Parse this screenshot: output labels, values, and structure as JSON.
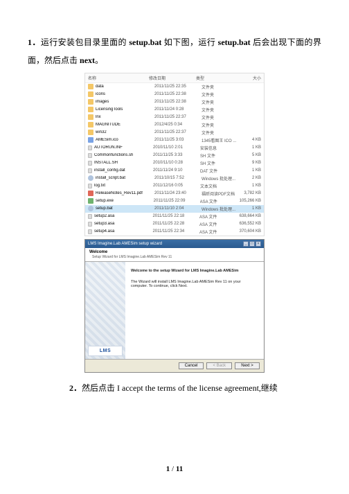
{
  "para1": {
    "num": "1．",
    "t1": "运行安装包目录里面的 ",
    "b1": "setup.bat",
    "t2": " 如下图，运行 ",
    "b2": "setup.bat",
    "t3": " 后会出现下面的界面，然后点击 ",
    "b3": "next",
    "t4": "。"
  },
  "explorer": {
    "head": {
      "name": "名称",
      "date": "修改日期",
      "type": "类型",
      "size": "大小"
    },
    "rows": [
      {
        "ic": "folder",
        "name": "data",
        "date": "2011/11/25 22:35",
        "type": "文件夹",
        "size": ""
      },
      {
        "ic": "folder",
        "name": "icons",
        "date": "2011/11/25 22:38",
        "type": "文件夹",
        "size": ""
      },
      {
        "ic": "folder",
        "name": "images",
        "date": "2011/11/25 22:38",
        "type": "文件夹",
        "size": ""
      },
      {
        "ic": "folder",
        "name": "LicensingTools",
        "date": "2011/11/24 0:28",
        "type": "文件夹",
        "size": ""
      },
      {
        "ic": "folder",
        "name": "lnx",
        "date": "2011/11/25 22:37",
        "type": "文件夹",
        "size": ""
      },
      {
        "ic": "folder",
        "name": "MAGNITUDE",
        "date": "2012/4/25 0:34",
        "type": "文件夹",
        "size": ""
      },
      {
        "ic": "folder",
        "name": "win32",
        "date": "2011/11/25 22:37",
        "type": "文件夹",
        "size": ""
      },
      {
        "ic": "ico",
        "name": "AMESim.ico",
        "date": "2011/11/25 3:03",
        "type": "1345看图王 ICO ...",
        "size": "4 KB"
      },
      {
        "ic": "file",
        "name": "AUTORUN.INF",
        "date": "2010/11/10 2:01",
        "type": "安装信息",
        "size": "1 KB"
      },
      {
        "ic": "file",
        "name": "Commonfunctions.sh",
        "date": "2011/11/25 3:33",
        "type": "SH 文件",
        "size": "5 KB"
      },
      {
        "ic": "file",
        "name": "INSTALL.SH",
        "date": "2010/11/10 0:28",
        "type": "SH 文件",
        "size": "9 KB"
      },
      {
        "ic": "file",
        "name": "install_config.dat",
        "date": "2011/11/24 9:10",
        "type": "DAT 文件",
        "size": "1 KB"
      },
      {
        "ic": "gear",
        "name": "install_script.bat",
        "date": "2011/10/15 7:52",
        "type": "Windows 批处理...",
        "size": "2 KB"
      },
      {
        "ic": "file",
        "name": "log.txt",
        "date": "2011/12/16 0:05",
        "type": "文本文档",
        "size": "1 KB"
      },
      {
        "ic": "pdf",
        "name": "ReleaseNotes_Rev11.pdf",
        "date": "2011/11/24 23:40",
        "type": "福昕阅读PDF文档",
        "size": "3,782 KB"
      },
      {
        "ic": "exe",
        "name": "setup.exe",
        "date": "2011/11/25 22:09",
        "type": "ASA 文件",
        "size": "105,266 KB"
      },
      {
        "ic": "gear",
        "name": "setup.bat",
        "date": "2011/11/10 2:04",
        "type": "Windows 批处理...",
        "size": "1 KB",
        "sel": true
      },
      {
        "ic": "file",
        "name": "setup2.asa",
        "date": "2011/11/25 22:18",
        "type": "ASA 文件",
        "size": "638,664 KB"
      },
      {
        "ic": "file",
        "name": "setup3.asa",
        "date": "2011/11/25 22:28",
        "type": "ASA 文件",
        "size": "636,552 KB"
      },
      {
        "ic": "file",
        "name": "setup4.asa",
        "date": "2011/11/25 22:34",
        "type": "ASA 文件",
        "size": "370,604 KB"
      }
    ]
  },
  "wizard": {
    "title": "LMS Imagine.Lab AMESim setup wizard",
    "header": "Welcome",
    "subheader": "Setup Wizard for LMS Imagine.Lab AMESim Rev 11",
    "body1": "Welcome to the setup Wizard for LMS Imagine.Lab AMESim",
    "body2": "The Wizard will install LMS Imagine.Lab AMESim Rev 11 on your computer. To continue, click Next.",
    "logo": "LMS",
    "btn_cancel": "Cancel",
    "btn_back": "< Back",
    "btn_next": "Next >"
  },
  "para2": {
    "num": "2．",
    "t1": "然后点击 I accept the terms of the license agreement,继续"
  },
  "pager": {
    "cur": "1",
    "sep": " / ",
    "total": "11"
  }
}
